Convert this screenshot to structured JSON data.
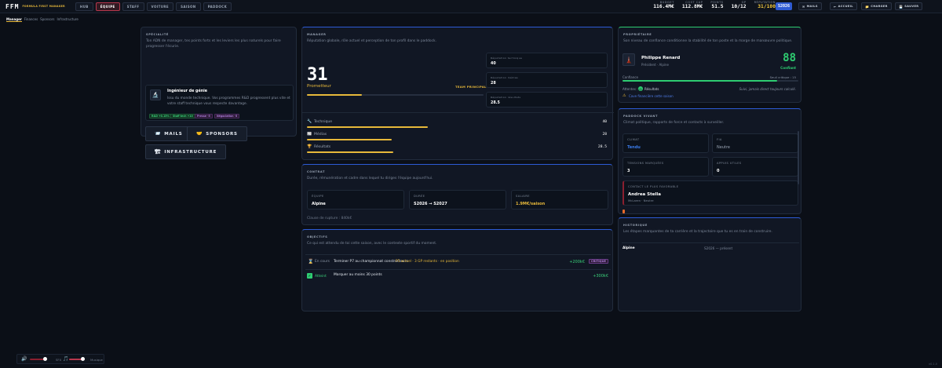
{
  "app": {
    "logo": "FFM",
    "subtitle": "FORMULA FIRST MANAGER"
  },
  "nav": {
    "tabs": [
      "HUB",
      "ÉQUIPE",
      "STAFF",
      "VOITURE",
      "SAISON",
      "PADDOCK"
    ],
    "active": "ÉQUIPE"
  },
  "stats": [
    {
      "label": "BUDGET",
      "value": "116.4M€"
    },
    {
      "label": "COST CAP",
      "value": "112.8M€"
    },
    {
      "label": "POINTS",
      "value": "51.5"
    },
    {
      "label": "GP",
      "value": "10/12"
    },
    {
      "label": "RÉPUTATION",
      "value": "31/100"
    }
  ],
  "season": "S2026",
  "toolbar": {
    "mails": "MAILS",
    "home": "ACCUEIL",
    "load": "CHARGER",
    "save": "SAUVER"
  },
  "subnav": [
    "Manager",
    "Finances",
    "Sponsors",
    "Infrastructure"
  ],
  "specialite": {
    "title": "SPÉCIALITÉ",
    "desc": "Ton ADN de manager, tes points forts et les leviers les plus naturels pour faire progresser l'écurie.",
    "name": "Ingénieur de génie",
    "text": "Issu du monde technique. Vos programmes R&D progressent plus vite et votre staff technique vous respecte davantage.",
    "tags": [
      "R&D +0.15%",
      "Staff tech +10",
      "Presse -5",
      "Négociation -5"
    ],
    "buttons": {
      "mails": "MAILS",
      "sponsors": "SPONSORS",
      "infra": "INFRASTRUCTURE"
    }
  },
  "manager": {
    "title": "MANAGER",
    "desc": "Réputation globale, rôle actuel et perception de ton profil dans le paddock.",
    "score": "31",
    "rank": "Prometteur",
    "role": "TEAM PRINCIPAL",
    "rep_fill": 0.31,
    "mini": [
      {
        "label": "Réputation technique",
        "value": "40"
      },
      {
        "label": "Réputation médias",
        "value": "28"
      },
      {
        "label": "Réputation résultats",
        "value": "28.5"
      }
    ],
    "rows": [
      {
        "label": "Technique",
        "value": "40",
        "icon": "wrench-icon",
        "glyph": "🔧"
      },
      {
        "label": "Médias",
        "value": "28",
        "icon": "flag-icon",
        "glyph": "📰"
      },
      {
        "label": "Résultats",
        "value": "28.5",
        "icon": "trophy-icon",
        "glyph": "🏆"
      }
    ]
  },
  "contrat": {
    "title": "CONTRAT",
    "desc": "Durée, rémunération et cadre dans lequel tu diriges l'équipe aujourd'hui.",
    "equipe_l": "ÉQUIPE",
    "equipe_v": "Alpine",
    "duree_l": "DURÉE",
    "duree_v": "S2026 → S2027",
    "salaire_l": "SALAIRE",
    "salaire_v": "1.9M€/saison",
    "clause": "Clause de rupture : 840k€"
  },
  "objectifs": {
    "title": "OBJECTIFS",
    "desc": "Ce qui est attendu de toi cette saison, avec le contexte sportif du moment.",
    "items": [
      {
        "status": "En cours",
        "text": "Terminer P7 au championnat constructeurs",
        "note": "P5 actuel · 3 GP restants · en position",
        "reward": "+200k€",
        "badge": "CRITIQUE"
      },
      {
        "status": "Atteint",
        "text": "Marquer au moins 30 points",
        "note": "",
        "reward": "+300k€",
        "badge": ""
      }
    ]
  },
  "proprietaire": {
    "title": "PROPRIÉTAIRE",
    "desc": "Son niveau de confiance conditionne la stabilité de ton poste et la marge de manœuvre politique.",
    "name": "Philippe Renard",
    "role": "Président · Alpine",
    "score": "88",
    "mood": "Confiant",
    "conf_label": "Confiance",
    "threshold": "Seuil critique : 15",
    "conf_fill": 0.88,
    "attentes_l": "Attentes :",
    "attentes_v": "Résultats",
    "quote": "Suivi, jamais direct toujours calculé.",
    "warning": "Cave financière cette saison"
  },
  "paddock": {
    "title": "PADDOCK VIVANT",
    "desc": "Climat politique, rapports de force et contacts à surveiller.",
    "cells": [
      {
        "label": "CLIMAT",
        "value": "Tendu"
      },
      {
        "label": "FIA",
        "value": "Neutre"
      },
      {
        "label": "TENSIONS MARQUÉES",
        "value": "3"
      },
      {
        "label": "APPUIS UTILES",
        "value": "0"
      }
    ],
    "contact_l": "CONTACT LE PLUS FAVORABLE",
    "contact_name": "Andrea Stella",
    "contact_sub": "McLaren · Neutre"
  },
  "historique": {
    "title": "HISTORIQUE",
    "desc": "Les étapes marquantes de ta carrière et la trajectoire que tu es en train de construire.",
    "row_team": "Alpine",
    "row_period": "S2026 — présent"
  },
  "footer": {
    "volume_l": "SFX",
    "music_l": "Musique",
    "version": "v0.1.0"
  },
  "colors": {
    "accent": "#e8b93a",
    "danger": "#b8374d",
    "ok": "#2ecc71",
    "blue": "#2d5bd6"
  }
}
